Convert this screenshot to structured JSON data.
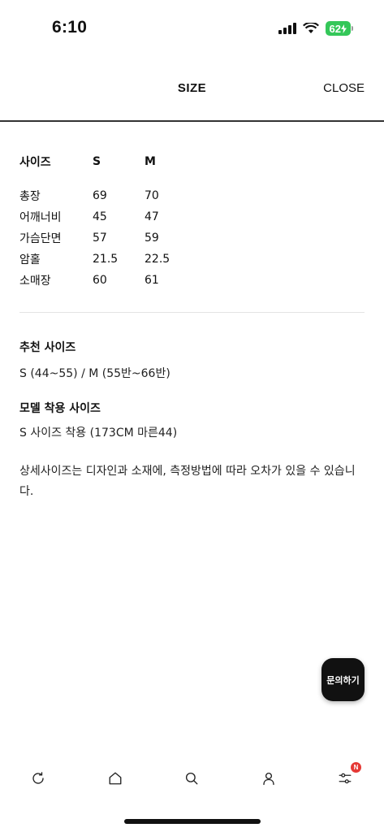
{
  "status_bar": {
    "time": "6:10",
    "battery": "62"
  },
  "header": {
    "title": "SIZE",
    "close_label": "CLOSE"
  },
  "size_table": {
    "columns": [
      "사이즈",
      "S",
      "M"
    ],
    "rows": [
      [
        "총장",
        "69",
        "70"
      ],
      [
        "어깨너비",
        "45",
        "47"
      ],
      [
        "가슴단면",
        "57",
        "59"
      ],
      [
        "암홀",
        "21.5",
        "22.5"
      ],
      [
        "소매장",
        "60",
        "61"
      ]
    ]
  },
  "recommended": {
    "title": "추천 사이즈",
    "text": "S (44~55) / M (55반~66반)"
  },
  "model": {
    "title": "모델 착용 사이즈",
    "text": "S 사이즈 착용 (173CM 마른44)"
  },
  "note": "상세사이즈는 디자인과 소재에, 측정방법에 따라 오차가 있을 수 있습니다.",
  "inquiry_button": "문의하기",
  "bottom_nav": {
    "items": [
      "refresh-icon",
      "home-icon",
      "search-icon",
      "user-icon",
      "filter-icon"
    ],
    "badge": "N"
  }
}
